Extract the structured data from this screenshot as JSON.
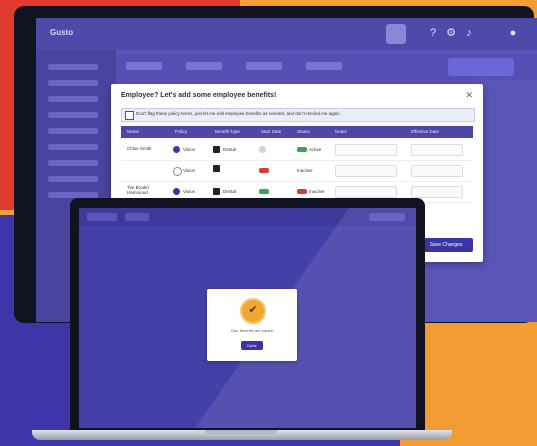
{
  "app": {
    "logo": "Gusto",
    "topbar_icons": [
      "help-icon",
      "gear-icon",
      "bell-icon",
      "user-icon"
    ]
  },
  "modal": {
    "title": "Employee? Let's add some employee benefits!",
    "close": "✕",
    "checkbox_text": "Don't flag these policy terms, just let me edit employee benefits as needed, and don't remind me again.",
    "columns": [
      "Name",
      "Policy",
      "Benefit Type",
      "Start Date",
      "Status",
      "Notes",
      "Effective Date"
    ],
    "save_label": "Save Changes",
    "rows": [
      {
        "name": "Chloe Smith",
        "policy": "Vision",
        "benefit": "Dental",
        "status": "Active"
      },
      {
        "name": "",
        "policy": "Vision",
        "benefit": "",
        "status": "Inactive"
      },
      {
        "name": "Tim Broder Hammond",
        "policy": "Vision",
        "benefit": "Dental",
        "status": "Inactive"
      }
    ]
  },
  "laptop": {
    "confirm_message": "Your benefits are saved!",
    "confirm_button": "Done"
  },
  "colors": {
    "brand": "#4d47a8",
    "accent": "#f2a531",
    "active": "#3aa655",
    "inactive": "#d93a3a"
  }
}
